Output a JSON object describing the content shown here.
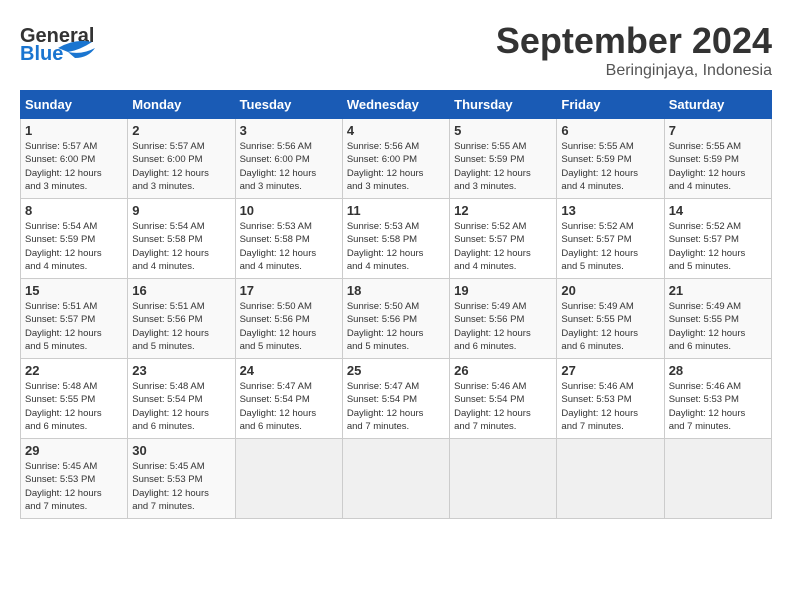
{
  "logo": {
    "line1": "General",
    "line2": "Blue"
  },
  "title": "September 2024",
  "location": "Beringinjaya, Indonesia",
  "headers": [
    "Sunday",
    "Monday",
    "Tuesday",
    "Wednesday",
    "Thursday",
    "Friday",
    "Saturday"
  ],
  "weeks": [
    [
      {
        "day": "1",
        "info": "Sunrise: 5:57 AM\nSunset: 6:00 PM\nDaylight: 12 hours\nand 3 minutes."
      },
      {
        "day": "2",
        "info": "Sunrise: 5:57 AM\nSunset: 6:00 PM\nDaylight: 12 hours\nand 3 minutes."
      },
      {
        "day": "3",
        "info": "Sunrise: 5:56 AM\nSunset: 6:00 PM\nDaylight: 12 hours\nand 3 minutes."
      },
      {
        "day": "4",
        "info": "Sunrise: 5:56 AM\nSunset: 6:00 PM\nDaylight: 12 hours\nand 3 minutes."
      },
      {
        "day": "5",
        "info": "Sunrise: 5:55 AM\nSunset: 5:59 PM\nDaylight: 12 hours\nand 3 minutes."
      },
      {
        "day": "6",
        "info": "Sunrise: 5:55 AM\nSunset: 5:59 PM\nDaylight: 12 hours\nand 4 minutes."
      },
      {
        "day": "7",
        "info": "Sunrise: 5:55 AM\nSunset: 5:59 PM\nDaylight: 12 hours\nand 4 minutes."
      }
    ],
    [
      {
        "day": "8",
        "info": "Sunrise: 5:54 AM\nSunset: 5:59 PM\nDaylight: 12 hours\nand 4 minutes."
      },
      {
        "day": "9",
        "info": "Sunrise: 5:54 AM\nSunset: 5:58 PM\nDaylight: 12 hours\nand 4 minutes."
      },
      {
        "day": "10",
        "info": "Sunrise: 5:53 AM\nSunset: 5:58 PM\nDaylight: 12 hours\nand 4 minutes."
      },
      {
        "day": "11",
        "info": "Sunrise: 5:53 AM\nSunset: 5:58 PM\nDaylight: 12 hours\nand 4 minutes."
      },
      {
        "day": "12",
        "info": "Sunrise: 5:52 AM\nSunset: 5:57 PM\nDaylight: 12 hours\nand 4 minutes."
      },
      {
        "day": "13",
        "info": "Sunrise: 5:52 AM\nSunset: 5:57 PM\nDaylight: 12 hours\nand 5 minutes."
      },
      {
        "day": "14",
        "info": "Sunrise: 5:52 AM\nSunset: 5:57 PM\nDaylight: 12 hours\nand 5 minutes."
      }
    ],
    [
      {
        "day": "15",
        "info": "Sunrise: 5:51 AM\nSunset: 5:57 PM\nDaylight: 12 hours\nand 5 minutes."
      },
      {
        "day": "16",
        "info": "Sunrise: 5:51 AM\nSunset: 5:56 PM\nDaylight: 12 hours\nand 5 minutes."
      },
      {
        "day": "17",
        "info": "Sunrise: 5:50 AM\nSunset: 5:56 PM\nDaylight: 12 hours\nand 5 minutes."
      },
      {
        "day": "18",
        "info": "Sunrise: 5:50 AM\nSunset: 5:56 PM\nDaylight: 12 hours\nand 5 minutes."
      },
      {
        "day": "19",
        "info": "Sunrise: 5:49 AM\nSunset: 5:56 PM\nDaylight: 12 hours\nand 6 minutes."
      },
      {
        "day": "20",
        "info": "Sunrise: 5:49 AM\nSunset: 5:55 PM\nDaylight: 12 hours\nand 6 minutes."
      },
      {
        "day": "21",
        "info": "Sunrise: 5:49 AM\nSunset: 5:55 PM\nDaylight: 12 hours\nand 6 minutes."
      }
    ],
    [
      {
        "day": "22",
        "info": "Sunrise: 5:48 AM\nSunset: 5:55 PM\nDaylight: 12 hours\nand 6 minutes."
      },
      {
        "day": "23",
        "info": "Sunrise: 5:48 AM\nSunset: 5:54 PM\nDaylight: 12 hours\nand 6 minutes."
      },
      {
        "day": "24",
        "info": "Sunrise: 5:47 AM\nSunset: 5:54 PM\nDaylight: 12 hours\nand 6 minutes."
      },
      {
        "day": "25",
        "info": "Sunrise: 5:47 AM\nSunset: 5:54 PM\nDaylight: 12 hours\nand 7 minutes."
      },
      {
        "day": "26",
        "info": "Sunrise: 5:46 AM\nSunset: 5:54 PM\nDaylight: 12 hours\nand 7 minutes."
      },
      {
        "day": "27",
        "info": "Sunrise: 5:46 AM\nSunset: 5:53 PM\nDaylight: 12 hours\nand 7 minutes."
      },
      {
        "day": "28",
        "info": "Sunrise: 5:46 AM\nSunset: 5:53 PM\nDaylight: 12 hours\nand 7 minutes."
      }
    ],
    [
      {
        "day": "29",
        "info": "Sunrise: 5:45 AM\nSunset: 5:53 PM\nDaylight: 12 hours\nand 7 minutes."
      },
      {
        "day": "30",
        "info": "Sunrise: 5:45 AM\nSunset: 5:53 PM\nDaylight: 12 hours\nand 7 minutes."
      },
      {
        "day": "",
        "info": ""
      },
      {
        "day": "",
        "info": ""
      },
      {
        "day": "",
        "info": ""
      },
      {
        "day": "",
        "info": ""
      },
      {
        "day": "",
        "info": ""
      }
    ]
  ]
}
